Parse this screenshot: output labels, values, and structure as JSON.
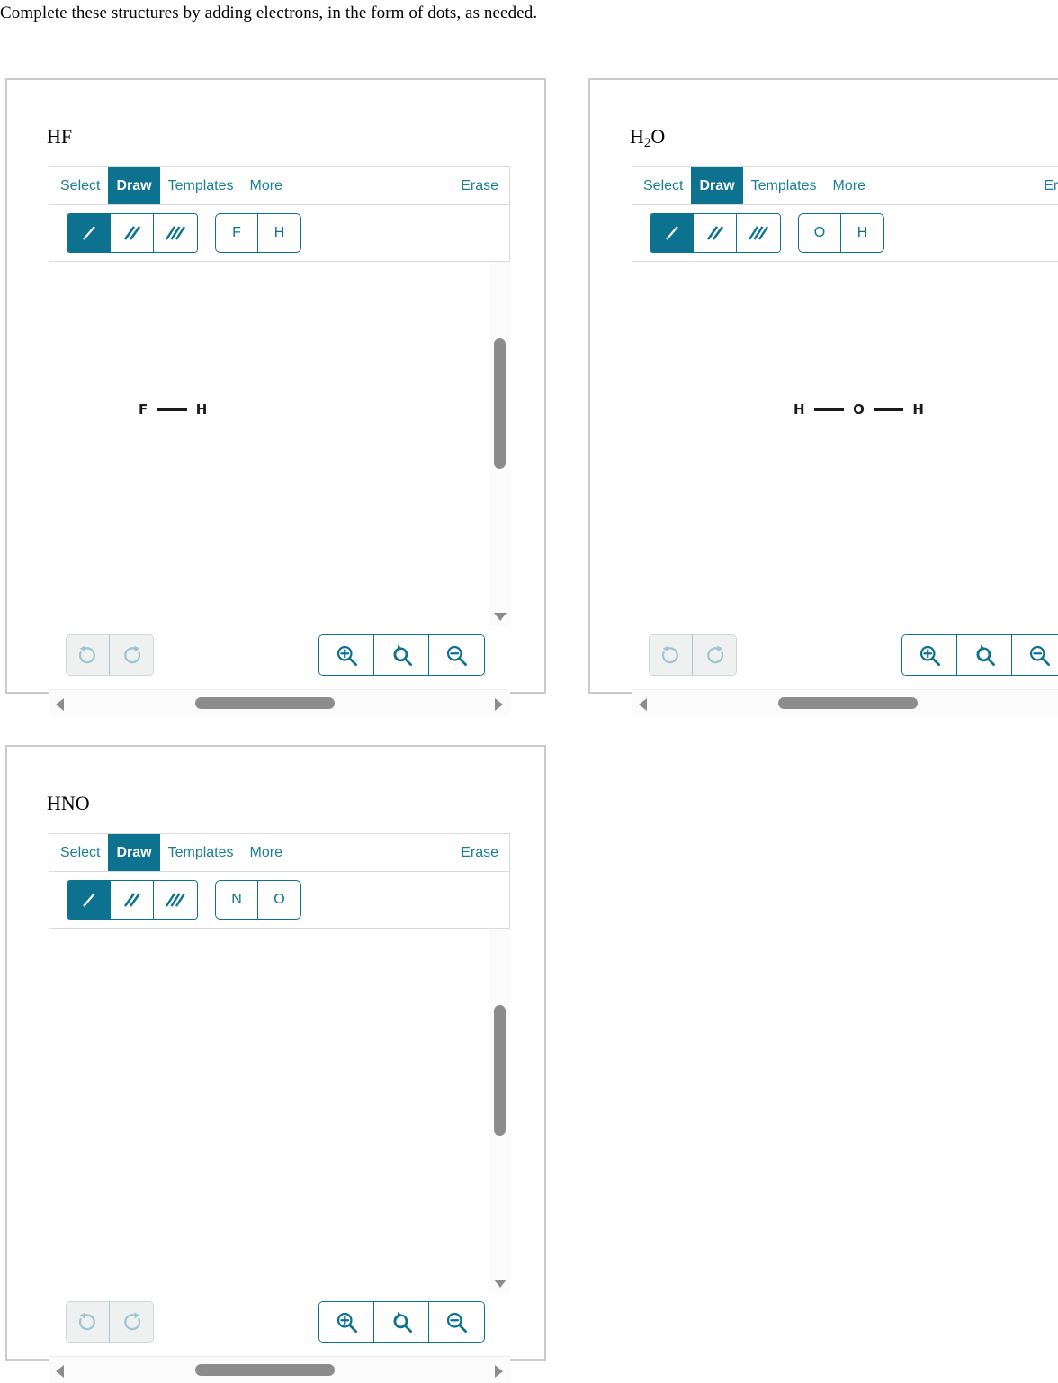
{
  "prompt": "Complete these structures by adding electrons, in the form of dots, as needed.",
  "colors": {
    "accent_teal": "#0d7290",
    "tab_link": "#187e99",
    "panel_border": "#c9cbcd",
    "scrollbar_thumb": "#8c8c8c",
    "disabled_icon": "#9dc6d2",
    "molecule_text": "#1b1b1b"
  },
  "toolbar": {
    "tabs": [
      {
        "label": "Select",
        "active": false
      },
      {
        "label": "Draw",
        "active": true
      },
      {
        "label": "Templates",
        "active": false
      },
      {
        "label": "More",
        "active": false
      }
    ],
    "erase_label": "Erase",
    "bond_tools": [
      {
        "name": "single-bond-icon",
        "active": true
      },
      {
        "name": "double-bond-icon",
        "active": false
      },
      {
        "name": "triple-bond-icon",
        "active": false
      }
    ],
    "controls": {
      "undo": "undo-icon",
      "redo": "redo-icon",
      "zoom_in": "zoom-in-icon",
      "zoom_reset": "zoom-reset-icon",
      "zoom_out": "zoom-out-icon"
    }
  },
  "panels": [
    {
      "id": "hf",
      "title": "HF",
      "title_base": "HF",
      "title_sub": "",
      "title_tail": "",
      "elements": [
        "F",
        "H"
      ],
      "molecule": {
        "left_atom": "F",
        "right_atom": "H",
        "center_atom": ""
      }
    },
    {
      "id": "h2o",
      "title": "H2O",
      "title_base": "H",
      "title_sub": "2",
      "title_tail": "O",
      "elements": [
        "O",
        "H"
      ],
      "molecule": {
        "left_atom": "H",
        "center_atom": "O",
        "right_atom": "H"
      }
    },
    {
      "id": "hno",
      "title": "HNO",
      "title_base": "HNO",
      "title_sub": "",
      "title_tail": "",
      "elements": [
        "N",
        "O"
      ],
      "molecule": {
        "left_atom": "",
        "center_atom": "",
        "right_atom": ""
      }
    }
  ]
}
